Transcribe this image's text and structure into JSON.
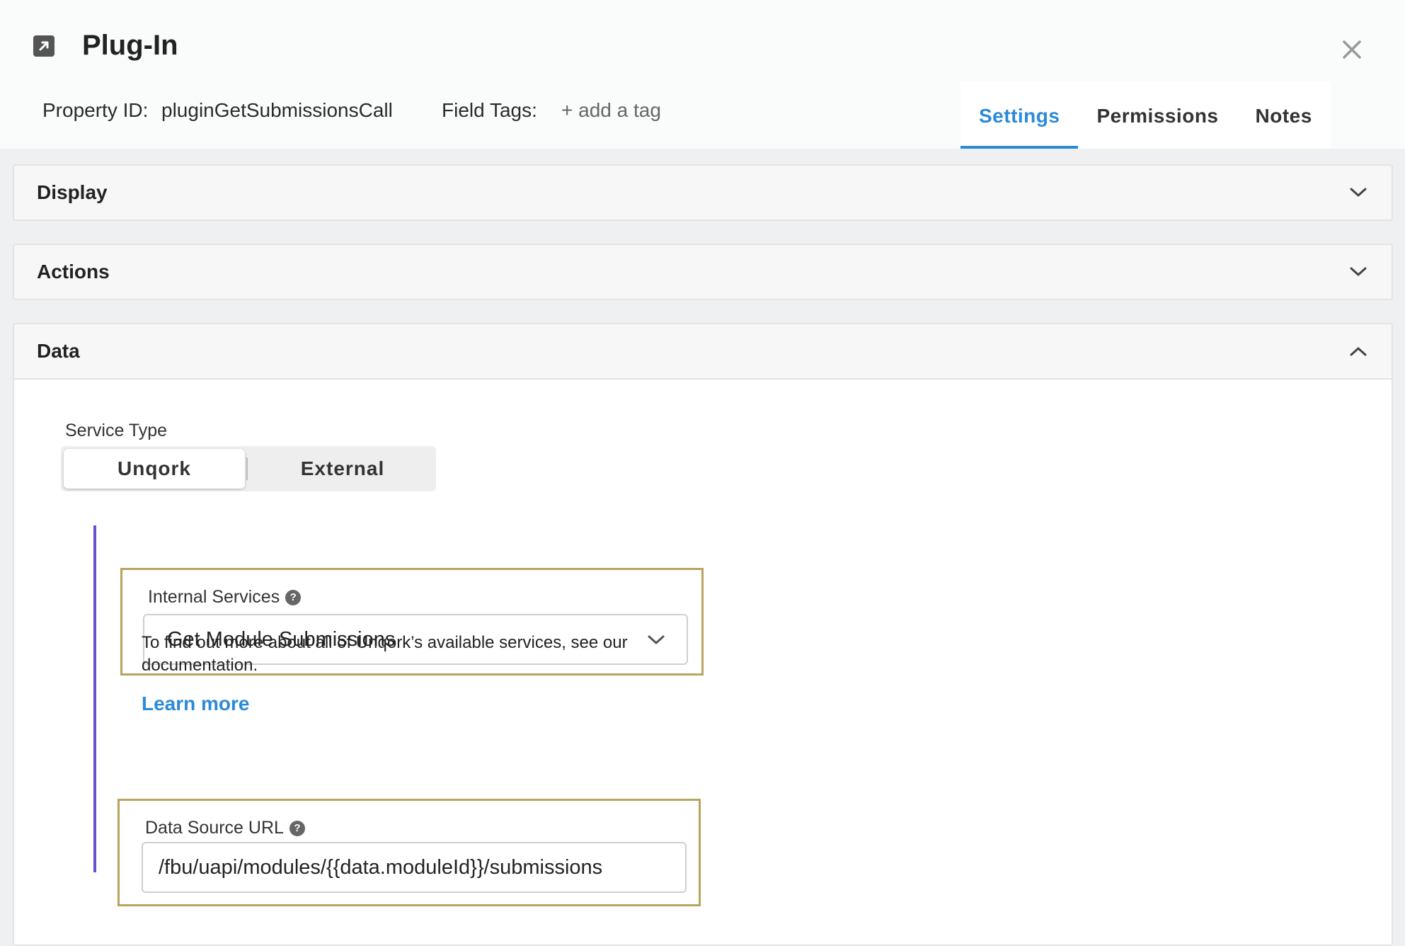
{
  "dialog": {
    "title": "Plug-In",
    "property_id_label": "Property ID:",
    "property_id_value": "pluginGetSubmissionsCall",
    "field_tags_label": "Field Tags:",
    "add_tag_label": "+ add a tag"
  },
  "tabs": [
    {
      "label": "Settings",
      "active": true
    },
    {
      "label": "Permissions",
      "active": false
    },
    {
      "label": "Notes",
      "active": false
    }
  ],
  "panels": {
    "display": {
      "title": "Display",
      "expanded": false
    },
    "actions": {
      "title": "Actions",
      "expanded": false
    },
    "data": {
      "title": "Data",
      "expanded": true
    }
  },
  "data_section": {
    "service_type_label": "Service Type",
    "service_type_options": [
      "Unqork",
      "External"
    ],
    "service_type_selected": "Unqork",
    "internal_services_label": "Internal Services",
    "internal_services_value": "Get Module Submissions",
    "help_text": "To find out more about all of Unqork’s available services, see our documentation.",
    "learn_more_label": "Learn more",
    "data_source_url_label": "Data Source URL",
    "data_source_url_value": "/fbu/uapi/modules/{{data.moduleId}}/submissions"
  },
  "colors": {
    "accent": "#2b8ad8",
    "highlight_border": "#b8a45c",
    "rail": "#6a4fd6"
  }
}
